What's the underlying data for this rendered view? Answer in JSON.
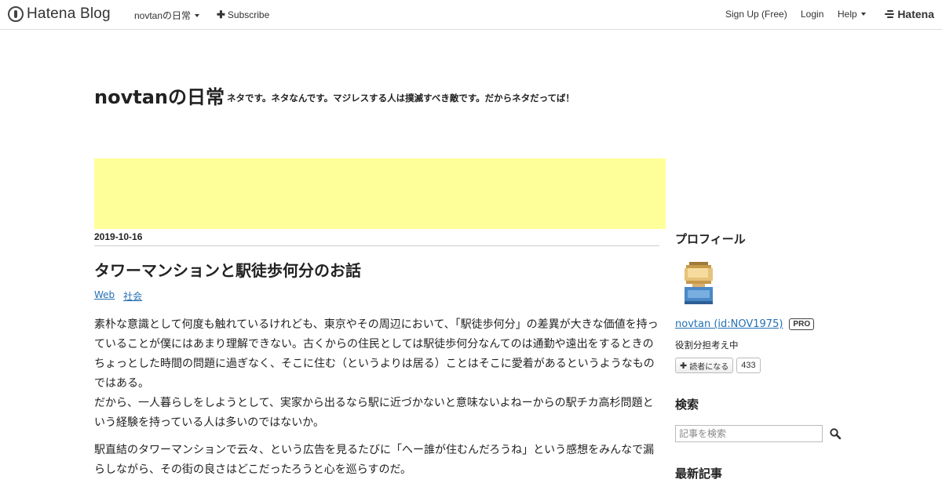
{
  "topbar": {
    "logo_text": "Hatena Blog",
    "blog_menu": "novtanの日常",
    "subscribe": "Subscribe",
    "signup": "Sign Up (Free)",
    "login": "Login",
    "help": "Help",
    "hatena": "Hatena"
  },
  "blog": {
    "title": "novtanの日常",
    "description": "ネタです。ネタなんです。マジレスする人は撲滅すべき敵です。だからネタだってば！"
  },
  "colors": {
    "ad_background": "#ffff99",
    "link": "#2470b3"
  },
  "entry": {
    "date": "2019-10-16",
    "title": "タワーマンションと駅徒歩何分のお話",
    "categories": [
      "Web",
      "社会"
    ],
    "paragraph1": "素朴な意識として何度も触れているけれども、東京やその周辺において、「駅徒歩何分」の差異が大きな価値を持っていることが僕にはあまり理解できない。古くからの住民としては駅徒歩何分なんてのは通勤や遠出をするときのちょっとした時間の問題に過ぎなく、そこに住む（というよりは居る）ことはそこに愛着があるというようなものではある。",
    "paragraph1b": "だから、一人暮らしをしようとして、実家から出るなら駅に近づかないと意味ないよねーからの駅チカ高杉問題という経験を持っている人は多いのではないか。",
    "paragraph2": "駅直結のタワーマンションで云々、という広告を見るたびに「へー誰が住むんだろうね」という感想をみんなで漏らしながら、その街の良さはどこだったろうと心を巡らすのだ。"
  },
  "sidebar": {
    "profile_heading": "プロフィール",
    "profile_name": "novtan (id:NOV1975)",
    "pro_badge": "PRO",
    "profile_desc": "役割分担考え中",
    "reader_button": "読者になる",
    "reader_count": "433",
    "search_heading": "検索",
    "search_placeholder": "記事を検索",
    "recent_heading": "最新記事"
  },
  "icons": [
    "hatena-blog-logo-icon",
    "caret-down-icon",
    "plus-icon",
    "hatena-logo-icon",
    "search-icon",
    "avatar-pixel-icon"
  ]
}
